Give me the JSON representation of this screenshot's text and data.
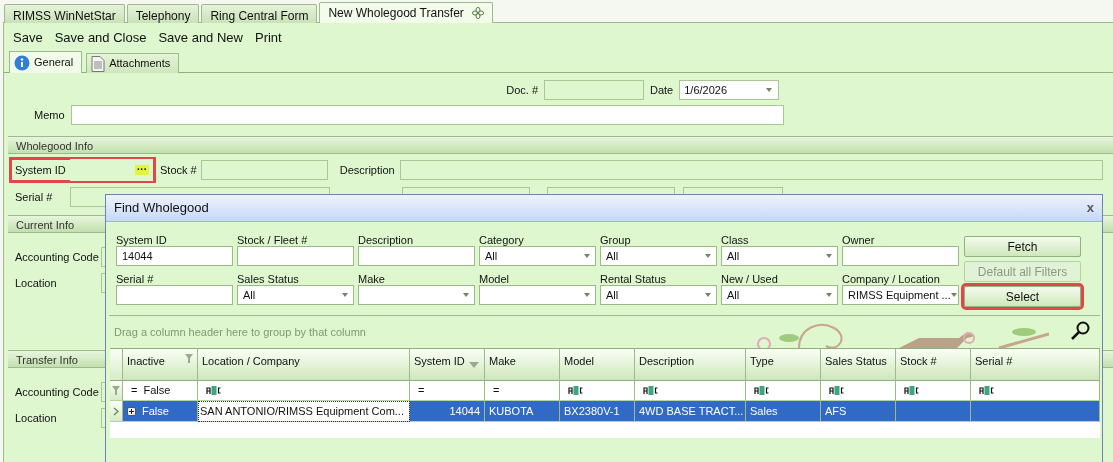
{
  "doc_tabs": [
    {
      "label": "RIMSS WinNetStar",
      "selected": false
    },
    {
      "label": "Telephony",
      "selected": false
    },
    {
      "label": "Ring Central Form",
      "selected": false
    },
    {
      "label": "New Wholegood Transfer",
      "selected": true
    }
  ],
  "toolbar": [
    "Save",
    "Save and Close",
    "Save and New",
    "Print"
  ],
  "form_tabs": [
    {
      "label": "General",
      "kind": "info",
      "selected": true
    },
    {
      "label": "Attachments",
      "kind": "document",
      "selected": false
    }
  ],
  "general": {
    "doc_label": "Doc. #",
    "date_label": "Date",
    "date_value": "1/6/2026",
    "memo_label": "Memo"
  },
  "wholegood_info": {
    "title": "Wholegood Info",
    "system_id_label": "System ID",
    "system_id_highlighted": true,
    "ellipsis": "···",
    "stock_label": "Stock #",
    "description_label": "Description",
    "serial_label": "Serial #"
  },
  "current_info": {
    "title": "Current Info",
    "fields": [
      "Accounting Code",
      "Location"
    ]
  },
  "transfer_info": {
    "title": "Transfer Info",
    "fields": [
      "Accounting Code",
      "Location"
    ]
  },
  "dialog": {
    "title": "Find Wholegood",
    "close": "x",
    "filters": [
      {
        "label": "System ID",
        "kind": "text",
        "value": "14044"
      },
      {
        "label": "Stock / Fleet #",
        "kind": "text"
      },
      {
        "label": "Description",
        "kind": "text"
      },
      {
        "label": "Category",
        "kind": "combo",
        "value": "All"
      },
      {
        "label": "Group",
        "kind": "combo",
        "value": "All"
      },
      {
        "label": "Class",
        "kind": "combo",
        "value": "All"
      },
      {
        "label": "Owner",
        "kind": "text"
      },
      {
        "label": "Serial #",
        "kind": "text"
      },
      {
        "label": "Sales Status",
        "kind": "combo",
        "value": "All"
      },
      {
        "label": "Make",
        "kind": "combo"
      },
      {
        "label": "Model",
        "kind": "combo"
      },
      {
        "label": "Rental Status",
        "kind": "combo",
        "value": "All"
      },
      {
        "label": "New / Used",
        "kind": "combo",
        "value": "All"
      },
      {
        "label": "Company / Location",
        "kind": "combo",
        "value": "RIMSS Equipment ..."
      }
    ],
    "buttons": [
      {
        "label": "Fetch",
        "disabled": false,
        "highlighted": false
      },
      {
        "label": "Default all Filters",
        "disabled": true,
        "highlighted": false
      },
      {
        "label": "Select",
        "disabled": false,
        "highlighted": true
      }
    ],
    "group_hint": "Drag a column header here to group by that column",
    "columns": [
      {
        "label": "Inactive",
        "filtered": true,
        "sorted": false
      },
      {
        "label": "Location / Company",
        "filtered": false,
        "sorted": false
      },
      {
        "label": "System ID",
        "filtered": false,
        "sorted": true
      },
      {
        "label": "Make",
        "filtered": false,
        "sorted": false
      },
      {
        "label": "Model",
        "filtered": false,
        "sorted": false
      },
      {
        "label": "Description",
        "filtered": false,
        "sorted": false
      },
      {
        "label": "Type",
        "filtered": false,
        "sorted": false
      },
      {
        "label": "Sales Status",
        "filtered": false,
        "sorted": false
      },
      {
        "label": "Stock #",
        "filtered": false,
        "sorted": false
      },
      {
        "label": "Serial #",
        "filtered": false,
        "sorted": false
      }
    ],
    "filter_row": [
      {
        "kind": "equals",
        "operator": "=",
        "value": "False"
      },
      {
        "kind": "like"
      },
      {
        "kind": "equals",
        "operator": "="
      },
      {
        "kind": "equals",
        "operator": "="
      },
      {
        "kind": "like"
      },
      {
        "kind": "like"
      },
      {
        "kind": "like"
      },
      {
        "kind": "like"
      },
      {
        "kind": "like"
      },
      {
        "kind": "like"
      }
    ],
    "rows": [
      {
        "selected": true,
        "cells": [
          {
            "text": "False",
            "focused": false
          },
          {
            "text": "SAN ANTONIO/RIMSS Equipment Com...",
            "focused": true
          },
          {
            "text": "14044",
            "focused": false
          },
          {
            "text": "KUBOTA",
            "focused": false
          },
          {
            "text": "BX2380V-1",
            "focused": false
          },
          {
            "text": "4WD BASE TRACT...",
            "focused": false
          },
          {
            "text": "Sales",
            "focused": false
          },
          {
            "text": "AFS",
            "focused": false
          },
          {
            "text": "",
            "focused": false
          },
          {
            "text": "",
            "focused": false
          }
        ]
      }
    ]
  }
}
